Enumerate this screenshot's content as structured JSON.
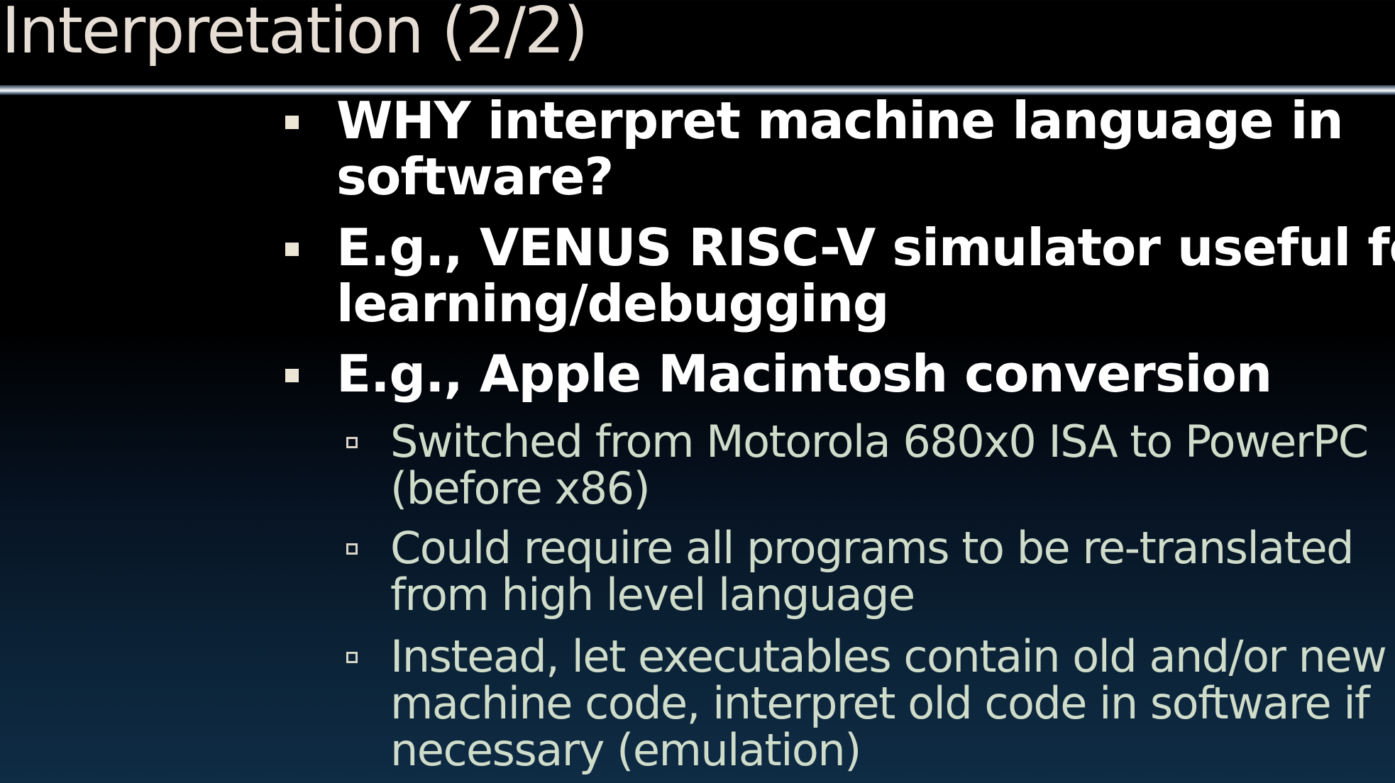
{
  "slide": {
    "title": "Interpretation (2/2)",
    "bullets": [
      {
        "level": 1,
        "lines": [
          "WHY interpret machine language in",
          "software?"
        ]
      },
      {
        "level": 1,
        "lines": [
          "E.g., VENUS RISC-V simulator useful for",
          "learning/debugging"
        ]
      },
      {
        "level": 1,
        "lines": [
          "E.g., Apple Macintosh conversion"
        ]
      },
      {
        "level": 2,
        "lines": [
          "Switched from Motorola 680x0 ISA to PowerPC",
          "(before x86)"
        ]
      },
      {
        "level": 2,
        "lines": [
          "Could require all programs to be re-translated",
          "from high level language"
        ]
      },
      {
        "level": 2,
        "lines": [
          "Instead, let executables contain old and/or new",
          "machine code, interpret old code in software if",
          "necessary (emulation)"
        ]
      }
    ]
  },
  "colors": {
    "title_text": "#e6ded4",
    "level1_text": "#ffffff",
    "level2_text": "#cfdcca",
    "background_top": "#000000",
    "background_bottom": "#0f2c45"
  }
}
